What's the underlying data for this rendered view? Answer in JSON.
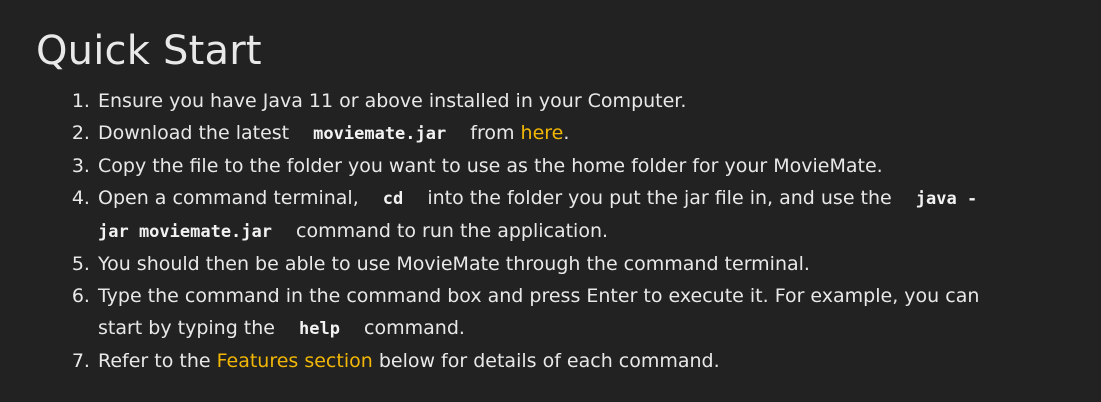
{
  "title": "Quick Start",
  "colors": {
    "background": "#222222",
    "text": "#e8e8e8",
    "link": "#f2b705"
  },
  "steps": [
    {
      "text": "Ensure you have Java 11 or above installed in your Computer."
    },
    {
      "pre": "Download the latest",
      "code": "moviemate.jar",
      "mid": "from",
      "link": "here",
      "post": "."
    },
    {
      "text": "Copy the file to the folder you want to use as the home folder for your MovieMate."
    },
    {
      "pre": "Open a command terminal,",
      "code1": "cd",
      "mid": "into the folder you put the jar file in, and use the",
      "code2": "java -jar moviemate.jar",
      "post": "command to run the application."
    },
    {
      "text": "You should then be able to use MovieMate through the command terminal."
    },
    {
      "pre": "Type the command in the command box and press Enter to execute it. For example, you can start by typing the",
      "code": "help",
      "post": "command."
    },
    {
      "pre": "Refer to the",
      "link": "Features section",
      "post": "below for details of each command."
    }
  ]
}
